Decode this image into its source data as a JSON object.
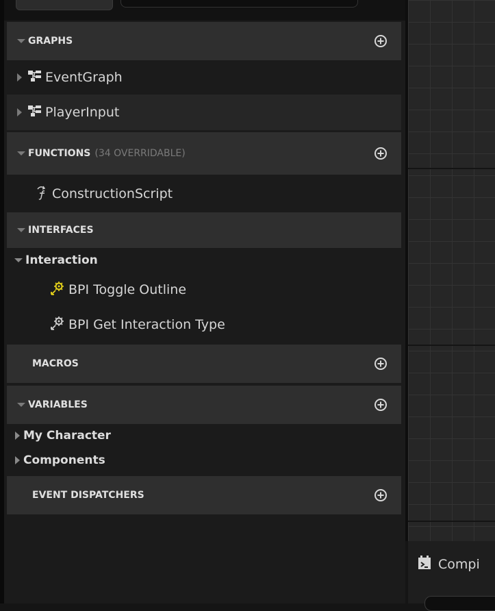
{
  "sections": {
    "graphs": {
      "title": "GRAPHS",
      "add_icon": "plus-circle-icon"
    },
    "functions": {
      "title": "FUNCTIONS",
      "subtitle": "(34 OVERRIDABLE)",
      "add_icon": "plus-circle-icon"
    },
    "interfaces": {
      "title": "INTERFACES"
    },
    "macros": {
      "title": "MACROS",
      "add_icon": "plus-circle-icon"
    },
    "variables": {
      "title": "VARIABLES",
      "add_icon": "plus-circle-icon"
    },
    "event_dispatchers": {
      "title": "EVENT DISPATCHERS",
      "add_icon": "plus-circle-icon"
    }
  },
  "graphs": [
    {
      "label": "EventGraph",
      "icon": "event-graph-icon"
    },
    {
      "label": "PlayerInput",
      "icon": "event-graph-icon"
    }
  ],
  "functions": [
    {
      "label": "ConstructionScript",
      "icon": "function-icon"
    }
  ],
  "interfaces": {
    "group": "Interaction",
    "items": [
      {
        "label": "BPI Toggle Outline",
        "icon": "interface-function-icon",
        "highlighted": true
      },
      {
        "label": "BPI Get Interaction Type",
        "icon": "interface-function-icon",
        "highlighted": false
      }
    ]
  },
  "variables": {
    "groups": [
      {
        "label": "My Character"
      },
      {
        "label": "Components"
      }
    ]
  },
  "bottom_panel": {
    "tab_label": "Compi",
    "icon": "compiler-results-icon"
  },
  "colors": {
    "category_bg": "#2f2f2f",
    "panel_bg": "#1b1b1b",
    "row_alt_bg": "#262626",
    "highlight_icon": "#e6d21a"
  }
}
